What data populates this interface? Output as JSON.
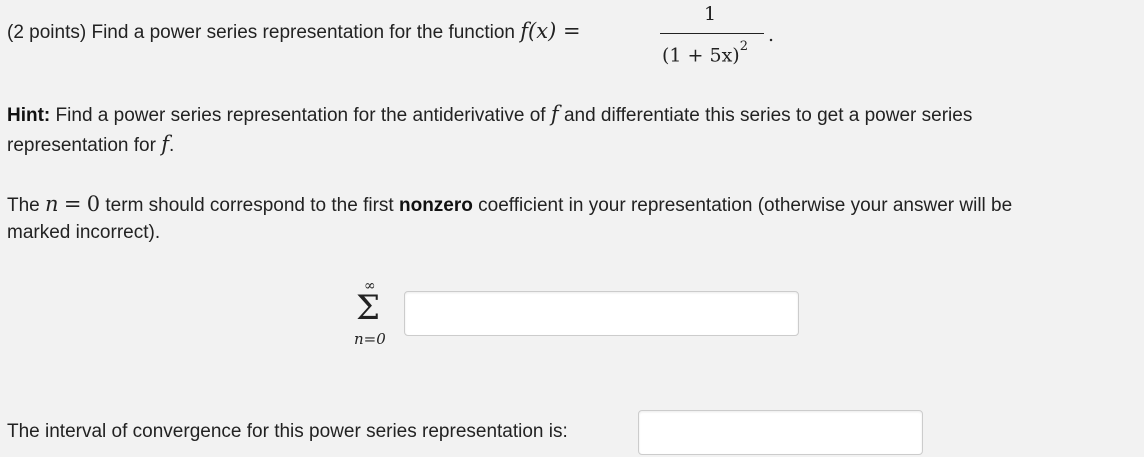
{
  "problem": {
    "points": "(2 points)",
    "prompt": "Find a power series representation for the function",
    "function_lhs": "f(x) =",
    "numerator": "1",
    "denominator": "(1 + 5x)",
    "exponent": "2",
    "end": "."
  },
  "hint": {
    "label": "Hint:",
    "text_1": "Find a power series representation for the antiderivative of",
    "f_symbol": "f",
    "text_2": "and differentiate this series to get a power series",
    "text_3": "representation for",
    "end": "."
  },
  "note": {
    "text_1": "The",
    "n_expr": "n",
    "eq": "=",
    "zero": "0",
    "text_2": "term should correspond to the first",
    "bold": "nonzero",
    "text_3": "coefficient in your representation (otherwise your answer will be",
    "text_4": "marked incorrect)."
  },
  "series": {
    "upper_limit": "∞",
    "sigma": "Σ",
    "lower_limit": "n=0",
    "input_value": "",
    "input_placeholder": ""
  },
  "interval": {
    "label": "The interval of convergence for this power series representation is:",
    "input_value": "",
    "input_placeholder": ""
  }
}
